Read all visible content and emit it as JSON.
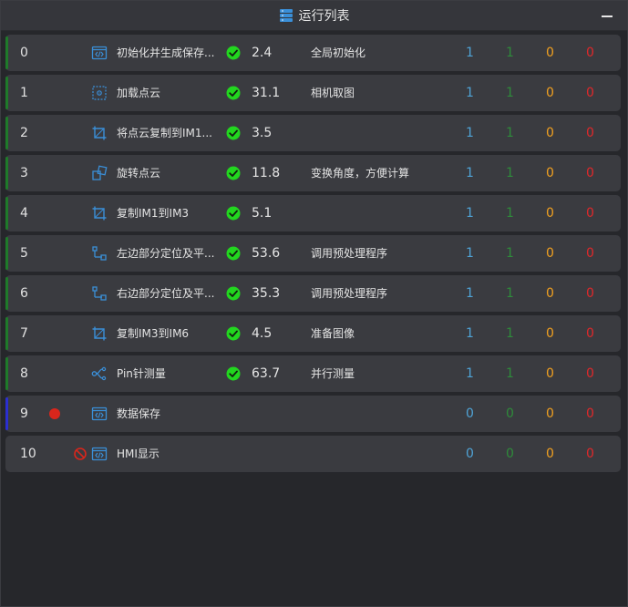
{
  "window": {
    "title": "运行列表",
    "title_icon": "server-list-icon",
    "minimize_icon": "minimize-icon"
  },
  "colors": {
    "accent_green": "#1f7a2a",
    "accent_blue": "#2b2fd0",
    "check_green": "#22d61f",
    "count_blue": "#4fa3d6",
    "count_green": "#2e8b3a",
    "count_orange": "#f0a020",
    "count_red": "#e0282a",
    "breakpoint_red": "#d9261c"
  },
  "rows": [
    {
      "index": "0",
      "icon": "script-icon",
      "name": "初始化并生成保存...",
      "time": "2.4",
      "note": "全局初始化",
      "c1": "1",
      "c2": "1",
      "c3": "0",
      "c4": "0",
      "status": "ok",
      "accent": "green"
    },
    {
      "index": "1",
      "icon": "point-cloud-icon",
      "name": "加载点云",
      "time": "31.1",
      "note": "相机取图",
      "c1": "1",
      "c2": "1",
      "c3": "0",
      "c4": "0",
      "status": "ok",
      "accent": "green"
    },
    {
      "index": "2",
      "icon": "crop-icon",
      "name": "将点云复制到IM1...",
      "time": "3.5",
      "note": "",
      "c1": "1",
      "c2": "1",
      "c3": "0",
      "c4": "0",
      "status": "ok",
      "accent": "green"
    },
    {
      "index": "3",
      "icon": "rotate-icon",
      "name": "旋转点云",
      "time": "11.8",
      "note": "变换角度，方便计算",
      "c1": "1",
      "c2": "1",
      "c3": "0",
      "c4": "0",
      "status": "ok",
      "accent": "green"
    },
    {
      "index": "4",
      "icon": "crop-icon",
      "name": "复制IM1到IM3",
      "time": "5.1",
      "note": "",
      "c1": "1",
      "c2": "1",
      "c3": "0",
      "c4": "0",
      "status": "ok",
      "accent": "green"
    },
    {
      "index": "5",
      "icon": "locate-icon",
      "name": "左边部分定位及平...",
      "time": "53.6",
      "note": "调用预处理程序",
      "c1": "1",
      "c2": "1",
      "c3": "0",
      "c4": "0",
      "status": "ok",
      "accent": "green"
    },
    {
      "index": "6",
      "icon": "locate-icon",
      "name": "右边部分定位及平...",
      "time": "35.3",
      "note": "调用预处理程序",
      "c1": "1",
      "c2": "1",
      "c3": "0",
      "c4": "0",
      "status": "ok",
      "accent": "green"
    },
    {
      "index": "7",
      "icon": "crop-icon",
      "name": "复制IM3到IM6",
      "time": "4.5",
      "note": "准备图像",
      "c1": "1",
      "c2": "1",
      "c3": "0",
      "c4": "0",
      "status": "ok",
      "accent": "green"
    },
    {
      "index": "8",
      "icon": "parallel-icon",
      "name": "Pin针测量",
      "time": "63.7",
      "note": "并行测量",
      "c1": "1",
      "c2": "1",
      "c3": "0",
      "c4": "0",
      "status": "ok",
      "accent": "green"
    },
    {
      "index": "9",
      "icon": "script-icon",
      "name": "数据保存",
      "time": "",
      "note": "",
      "c1": "0",
      "c2": "0",
      "c3": "0",
      "c4": "0",
      "status": "breakpoint",
      "accent": "blue"
    },
    {
      "index": "10",
      "icon": "script-icon",
      "name": "HMI显示",
      "time": "",
      "note": "",
      "c1": "0",
      "c2": "0",
      "c3": "0",
      "c4": "0",
      "status": "disabled",
      "accent": "none"
    }
  ]
}
